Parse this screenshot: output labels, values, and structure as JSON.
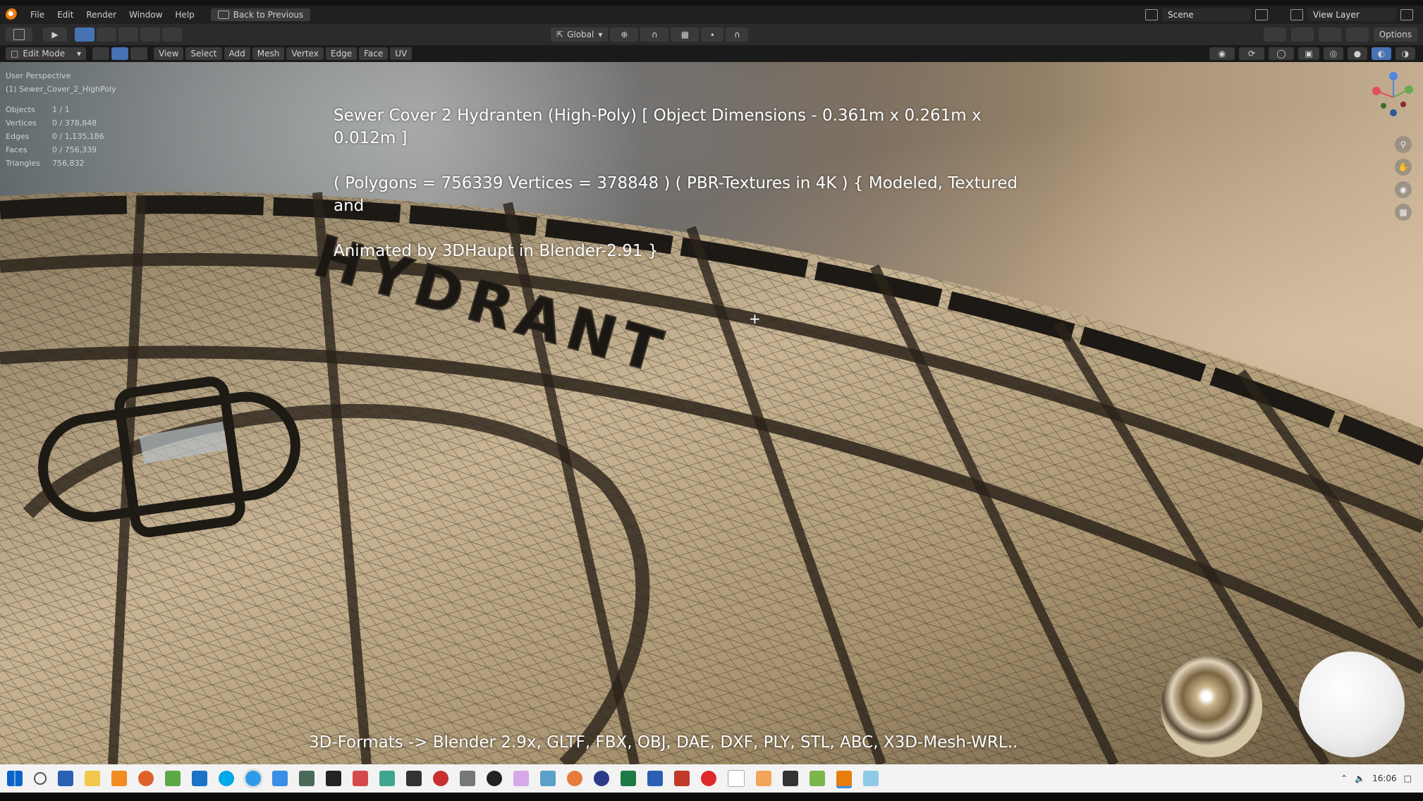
{
  "menubar": {
    "items": [
      "File",
      "Edit",
      "Render",
      "Window",
      "Help"
    ],
    "back_label": "Back to Previous",
    "scene": "Scene",
    "view_layer": "View Layer"
  },
  "toolbar": {
    "orientation": "Global",
    "options": "Options"
  },
  "header": {
    "mode": "Edit Mode",
    "menus": [
      "View",
      "Select",
      "Add",
      "Mesh",
      "Vertex",
      "Edge",
      "Face",
      "UV"
    ]
  },
  "overlay": {
    "view_name": "User Perspective",
    "object_name": "(1) Sewer_Cover_2_HighPoly",
    "stats": [
      {
        "label": "Objects",
        "value": "1 / 1"
      },
      {
        "label": "Vertices",
        "value": "0 / 378,848"
      },
      {
        "label": "Edges",
        "value": "0 / 1,135,186"
      },
      {
        "label": "Faces",
        "value": "0 / 756,339"
      },
      {
        "label": "Triangles",
        "value": "756,832"
      }
    ]
  },
  "caption": {
    "line1": "Sewer Cover 2 Hydranten (High-Poly) [ Object Dimensions -  0.361m x 0.261m x 0.012m ]",
    "line2": "( Polygons = 756339 Vertices = 378848 ) ( PBR-Textures in 4K ) { Modeled, Textured and",
    "line3": "Animated by 3DHaupt in Blender-2.91 }",
    "formats": "3D-Formats -> Blender 2.9x, GLTF, FBX, OBJ, DAE, DXF, PLY, STL, ABC, X3D-Mesh-WRL.."
  },
  "model": {
    "embossed_text": "HYDRANT"
  },
  "taskbar": {
    "time": "16:06"
  },
  "colors": {
    "accent": "#4772b3",
    "blender_orange": "#e87d0d"
  }
}
